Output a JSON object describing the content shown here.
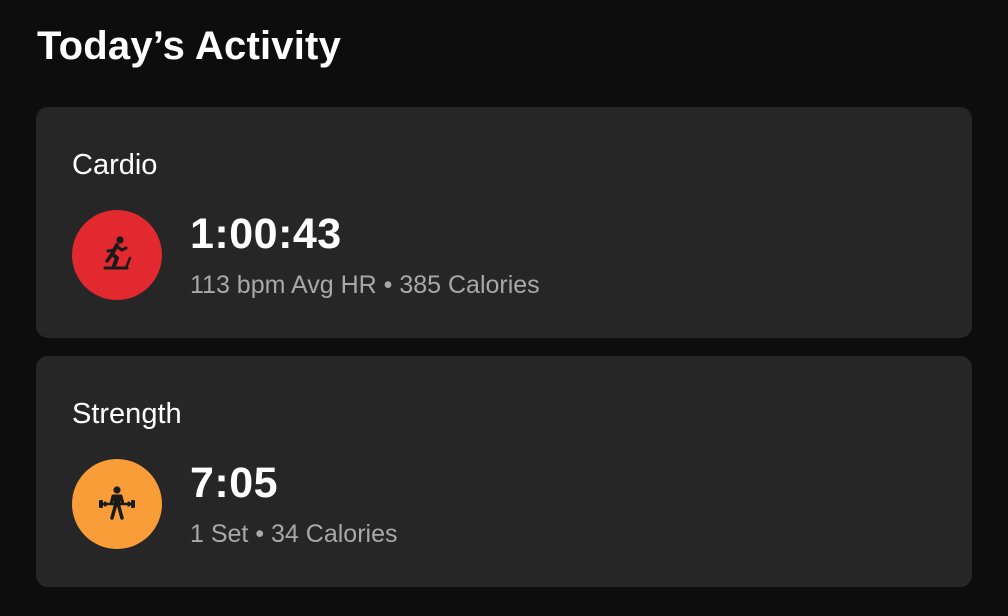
{
  "page": {
    "title": "Today’s Activity"
  },
  "activities": [
    {
      "label": "Cardio",
      "icon": "treadmill-runner-icon",
      "icon_color": "#e2292f",
      "duration": "1:00:43",
      "details": "113 bpm Avg HR • 385 Calories"
    },
    {
      "label": "Strength",
      "icon": "weightlifter-icon",
      "icon_color": "#f99d38",
      "duration": "7:05",
      "details": "1 Set • 34 Calories"
    }
  ],
  "colors": {
    "background": "#0d0d0d",
    "card": "#262626",
    "primary_text": "#ffffff",
    "secondary_text": "#a8a8a8"
  }
}
